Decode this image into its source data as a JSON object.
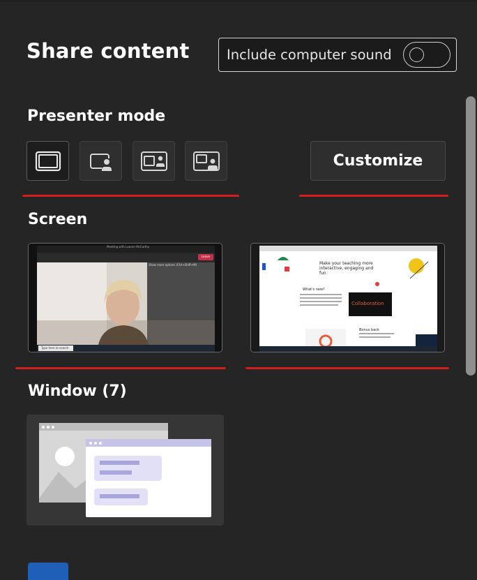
{
  "panel": {
    "title": "Share content",
    "sound_toggle": {
      "label": "Include computer sound",
      "on": false
    }
  },
  "presenter_mode": {
    "title": "Presenter mode",
    "modes": [
      {
        "icon": "content-only-icon",
        "selected": true
      },
      {
        "icon": "standout-icon",
        "selected": false
      },
      {
        "icon": "side-by-side-icon",
        "selected": false
      },
      {
        "icon": "reporter-icon",
        "selected": false
      }
    ],
    "customize_label": "Customize"
  },
  "screen": {
    "title": "Screen",
    "thumbnails": [
      {
        "window_title": "Meeting with Lauren McCarthy",
        "badge": "Leave",
        "caption": "Show more options (Ctrl+Shift+M)",
        "search_placeholder": "Type here to search"
      },
      {
        "headline": "Make your teaching more interactive, engaging and fun",
        "section_heading": "What's new?",
        "banner_text": "Collaboration",
        "section_heading_2": "Bonus back"
      }
    ]
  },
  "window": {
    "title": "Window (7)"
  },
  "colors": {
    "background": "#252525",
    "highlight": "#d21d1d",
    "accent": "#1f5fb8",
    "window_illustration": "#c5c3e8"
  }
}
